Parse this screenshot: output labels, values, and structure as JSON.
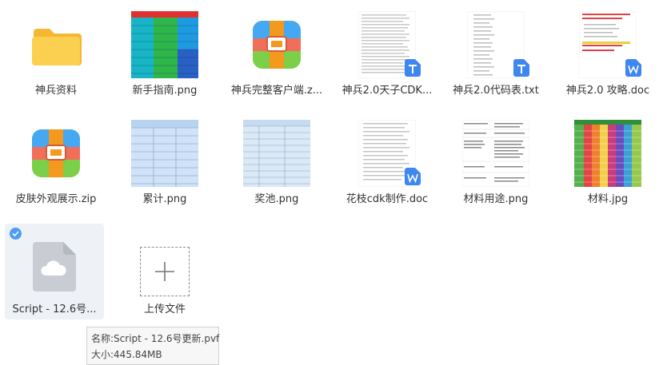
{
  "files": [
    {
      "name": "神兵资料",
      "type": "folder"
    },
    {
      "name": "新手指南.png",
      "type": "image-table"
    },
    {
      "name": "神兵完整客户端.z...",
      "type": "archive"
    },
    {
      "name": "神兵2.0天子CDK...",
      "type": "text"
    },
    {
      "name": "神兵2.0代码表.txt",
      "type": "text"
    },
    {
      "name": "神兵2.0 攻略.doc",
      "type": "doc"
    },
    {
      "name": "皮肤外观展示.zip",
      "type": "archive"
    },
    {
      "name": "累计.png",
      "type": "image-table"
    },
    {
      "name": "奖池.png",
      "type": "image-table"
    },
    {
      "name": "花枝cdk制作.doc",
      "type": "doc"
    },
    {
      "name": "材料用途.png",
      "type": "image-text"
    },
    {
      "name": "材料.jpg",
      "type": "image-colorful"
    },
    {
      "name": "Script - 12.6号...",
      "type": "cloud-file",
      "selected": true
    },
    {
      "name": "上传文件",
      "type": "upload"
    }
  ],
  "tooltip": {
    "name_line": "名称:Script - 12.6号更新.pvf",
    "size_line": "大小:445.84MB"
  },
  "colors": {
    "folder": "#f7c340",
    "archive_top": "#48a8f0",
    "archive_bottom": "#7ed04a",
    "archive_band": "#f07058",
    "archive_strap": "#f59a1e",
    "badge_blue": "#3e86f0",
    "selection": "#eef1f6"
  }
}
